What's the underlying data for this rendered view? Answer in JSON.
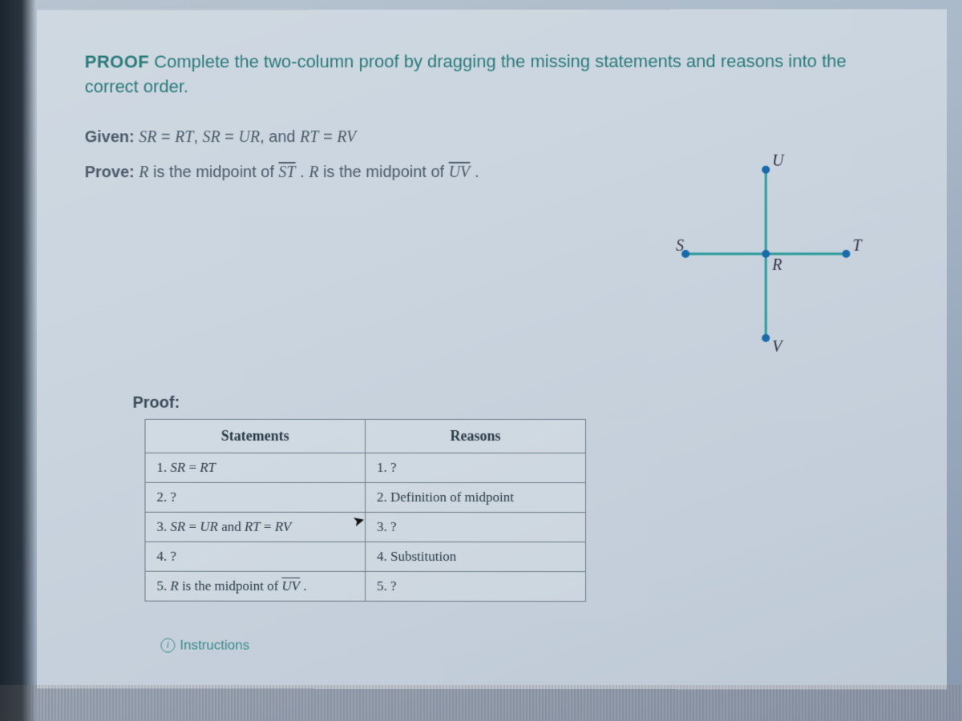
{
  "header": {
    "label": "PROOF",
    "instruction": "Complete the two-column proof by dragging the missing statements and reasons into the correct order."
  },
  "given": {
    "label": "Given:",
    "text_plain": "SR = RT, SR = UR, and RT = RV"
  },
  "prove": {
    "label": "Prove:",
    "text_plain": "R is the midpoint of ST . R is the midpoint of UV ."
  },
  "figure": {
    "points": {
      "U": "U",
      "V": "V",
      "S": "S",
      "T": "T",
      "R": "R"
    }
  },
  "proof": {
    "title": "Proof:",
    "columns": {
      "statements": "Statements",
      "reasons": "Reasons"
    },
    "rows": [
      {
        "statement": "1. SR = RT",
        "reason": "1. ?"
      },
      {
        "statement": "2. ?",
        "reason": "2. Definition of midpoint"
      },
      {
        "statement": "3. SR = UR and RT = RV",
        "reason": "3. ?"
      },
      {
        "statement": "4. ?",
        "reason": "4. Substitution"
      },
      {
        "statement": "5. R is the midpoint of UV .",
        "reason": "5. ?"
      }
    ]
  },
  "instructions_link": "Instructions",
  "chart_data": {
    "type": "table",
    "title": "Two-column proof",
    "columns": [
      "Statements",
      "Reasons"
    ],
    "rows": [
      [
        "1. SR = RT",
        "1. ?"
      ],
      [
        "2. ?",
        "2. Definition of midpoint"
      ],
      [
        "3. SR = UR and RT = RV",
        "3. ?"
      ],
      [
        "4. ?",
        "4. Substitution"
      ],
      [
        "5. R is the midpoint of UV",
        "5. ?"
      ]
    ]
  }
}
